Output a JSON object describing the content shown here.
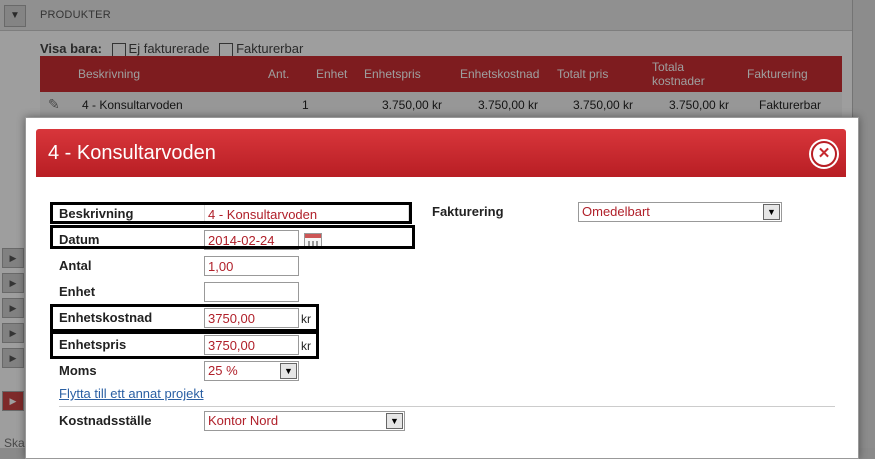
{
  "background": {
    "section_title": "PRODUKTER",
    "filter_label": "Visa bara:",
    "filter_options": [
      "Ej fakturerade",
      "Fakturerbar"
    ],
    "columns": [
      "Beskrivning",
      "Ant.",
      "Enhet",
      "Enhetspris",
      "Enhetskostnad",
      "Totalt pris",
      "Totala kostnader",
      "Fakturering"
    ],
    "row": {
      "beskrivning": "4 - Konsultarvoden",
      "ant": "1",
      "enhet": "",
      "enhetspris": "3.750,00 kr",
      "enhetskostnad": "3.750,00 kr",
      "totalt_pris": "3.750,00 kr",
      "totala_kostnader": "3.750,00 kr",
      "fakturering": "Fakturerbar"
    },
    "footer_fragment": "Ska"
  },
  "dialog": {
    "title": "4 - Konsultarvoden",
    "fields": {
      "beskrivning": {
        "label": "Beskrivning",
        "value": "4 - Konsultarvoden"
      },
      "datum": {
        "label": "Datum",
        "value": "2014-02-24"
      },
      "antal": {
        "label": "Antal",
        "value": "1,00"
      },
      "enhet": {
        "label": "Enhet",
        "value": ""
      },
      "enhetskostnad": {
        "label": "Enhetskostnad",
        "value": "3750,00",
        "unit": "kr"
      },
      "enhetspris": {
        "label": "Enhetspris",
        "value": "3750,00",
        "unit": "kr"
      },
      "moms": {
        "label": "Moms",
        "value": "25 %"
      },
      "fakturering": {
        "label": "Fakturering",
        "value": "Omedelbart"
      },
      "kostnadsstalle": {
        "label": "Kostnadsställe",
        "value": "Kontor Nord"
      }
    },
    "move_link": "Flytta till ett annat projekt"
  },
  "colors": {
    "accent": "#cc2e33",
    "value_text": "#b0202a",
    "link": "#2a5fa3"
  }
}
